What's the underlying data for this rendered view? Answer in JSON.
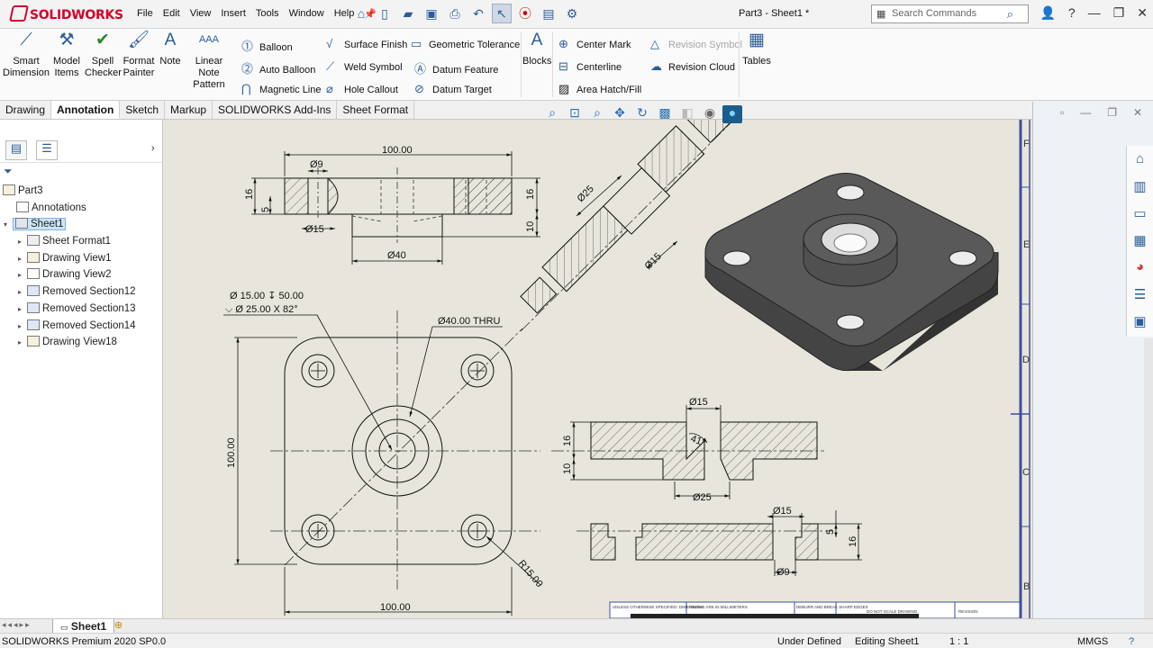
{
  "app": {
    "logo": "SOLIDWORKS",
    "doc_title": "Part3 - Sheet1 *"
  },
  "menu": [
    "File",
    "Edit",
    "View",
    "Insert",
    "Tools",
    "Window",
    "Help"
  ],
  "search": {
    "placeholder": "Search Commands"
  },
  "ribbon": {
    "smart_dimension": "Smart Dimension",
    "model_items": "Model Items",
    "spell_checker": "Spell Checker",
    "format_painter": "Format Painter",
    "note": "Note",
    "linear_note_pattern": "Linear Note Pattern",
    "balloon": "Balloon",
    "auto_balloon": "Auto Balloon",
    "magnetic_line": "Magnetic Line",
    "surface_finish": "Surface Finish",
    "weld_symbol": "Weld Symbol",
    "hole_callout": "Hole Callout",
    "geometric_tolerance": "Geometric Tolerance",
    "datum_feature": "Datum Feature",
    "datum_target": "Datum Target",
    "blocks": "Blocks",
    "center_mark": "Center Mark",
    "centerline": "Centerline",
    "area_hatch": "Area Hatch/Fill",
    "revision_symbol": "Revision Symbol",
    "revision_cloud": "Revision Cloud",
    "tables": "Tables"
  },
  "tabs": [
    "Drawing",
    "Annotation",
    "Sketch",
    "Markup",
    "SOLIDWORKS Add-Ins",
    "Sheet Format"
  ],
  "active_tab": "Annotation",
  "tree": {
    "root": "Part3",
    "annotations": "Annotations",
    "sheet": "Sheet1",
    "children": [
      "Sheet Format1",
      "Drawing View1",
      "Drawing View2",
      "Removed Section12",
      "Removed Section13",
      "Removed Section14",
      "Drawing View18"
    ]
  },
  "drawing": {
    "dim_100_top": "100.00",
    "dim_phi9_top": "Ø9",
    "dim_16_left": "16",
    "dim_5_left": "5",
    "dim_16_right": "16",
    "dim_10_right": "10",
    "dim_phi15_top": "Ø15",
    "dim_phi40": "Ø40",
    "callout_line1": "Ø 15.00 ↧ 50.00",
    "callout_line2": "⌵ Ø 25.00 X 82°",
    "dim_phi40_thru": "Ø40.00 THRU",
    "dim_100_left": "100.00",
    "dim_100_bottom": "100.00",
    "dim_r15": "R15.00",
    "sec_phi25": "Ø25",
    "sec_phi15": "Ø15",
    "sec2_phi15": "Ø15",
    "sec2_41": "41°",
    "sec2_16": "16",
    "sec2_10": "10",
    "sec2_phi25": "Ø25",
    "sec3_phi15": "Ø15",
    "sec3_5": "5",
    "sec3_16": "16",
    "sec3_phi9": "Ø9",
    "border_letters": [
      "F",
      "E",
      "D",
      "C",
      "B"
    ],
    "title_block": {
      "c1": "UNLESS OTHERWISE SPECIFIED: DIMENSIONS ARE IN MILLIMETERS",
      "c2": "FINISH:",
      "c3": "DEBURR AND BREAK SHARP EDGES",
      "c4": "DO NOT SCALE DRAWING",
      "c5": "REVISION"
    }
  },
  "sheet_tab": "Sheet1",
  "status": {
    "version": "SOLIDWORKS Premium 2020 SP0.0",
    "state": "Under Defined",
    "editing": "Editing Sheet1",
    "scale": "1 : 1",
    "units": "MMGS"
  }
}
